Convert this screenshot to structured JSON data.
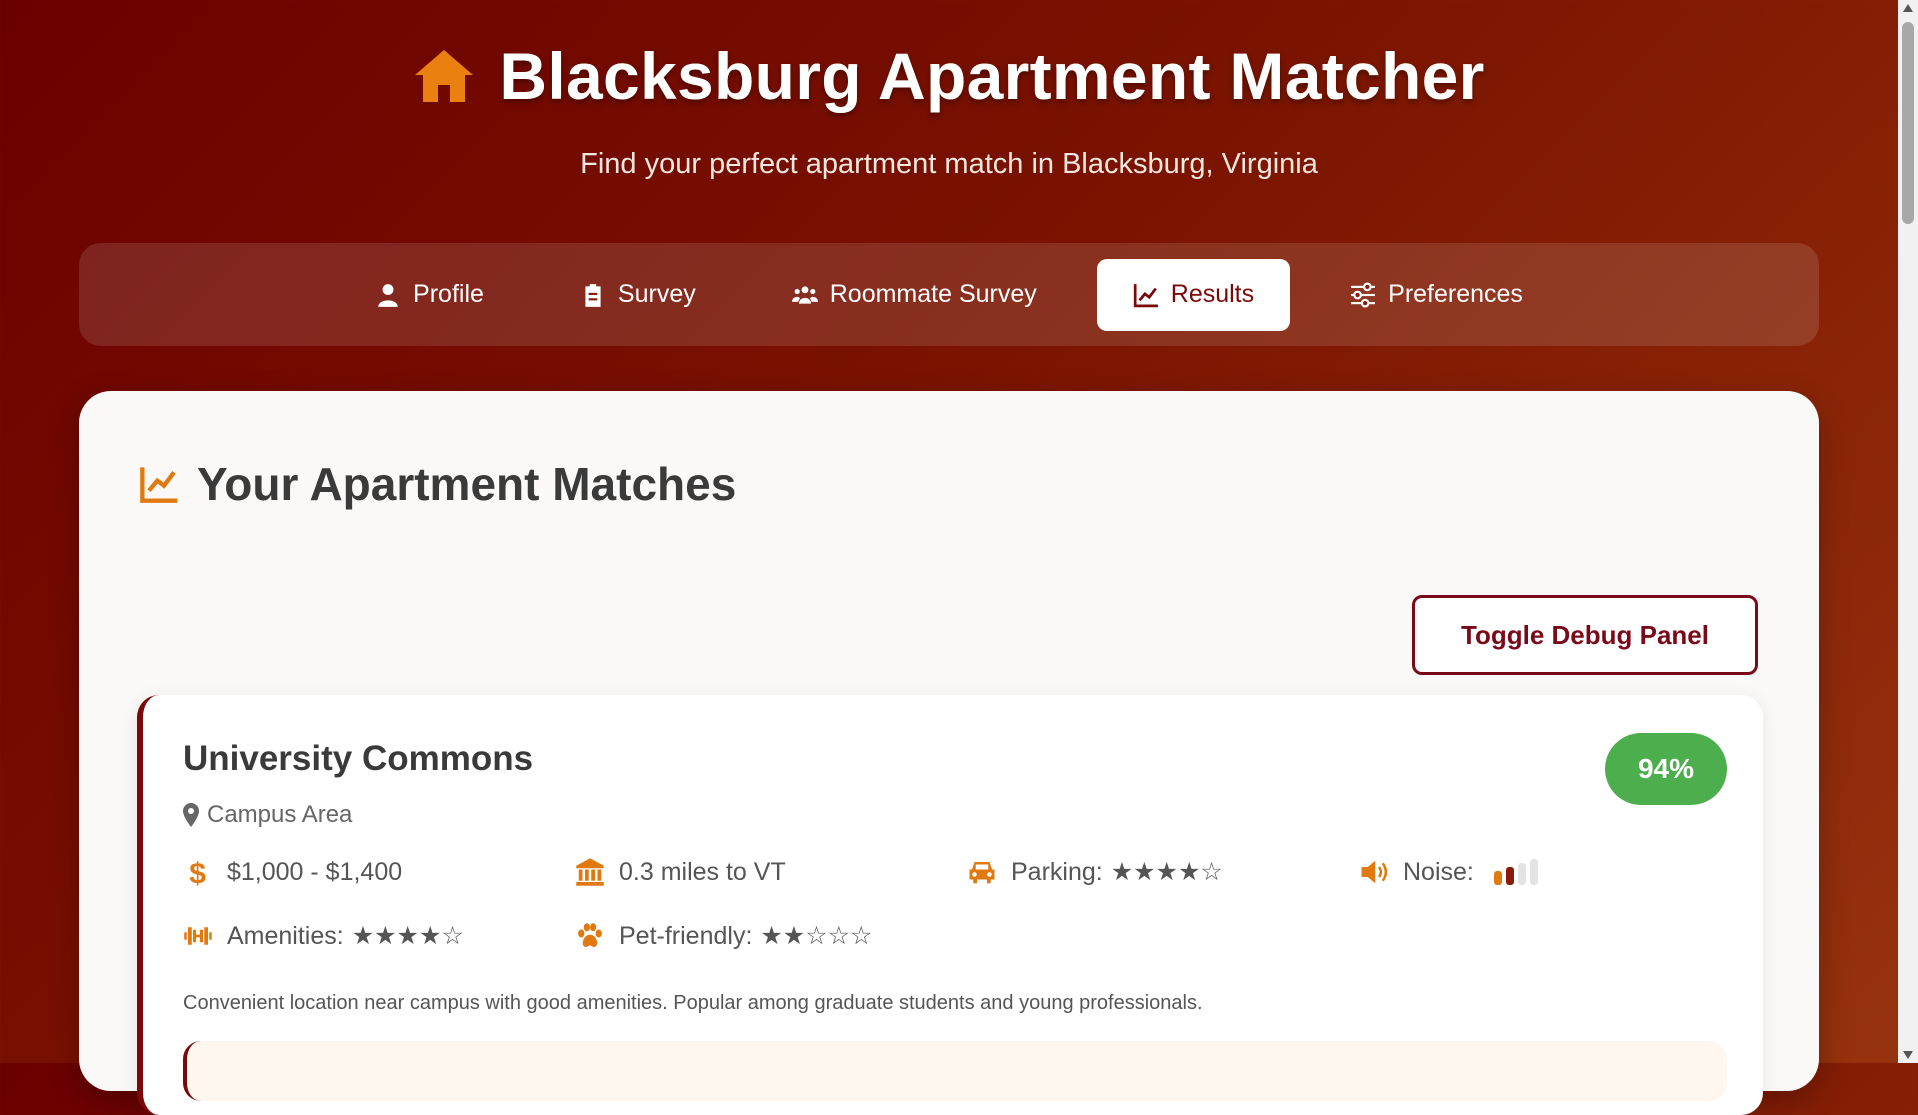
{
  "header": {
    "title": "Blacksburg Apartment Matcher",
    "subtitle": "Find your perfect apartment match in Blacksburg, Virginia",
    "icon": "home-icon"
  },
  "nav": {
    "tabs": [
      {
        "label": "Profile",
        "icon": "user-icon",
        "active": false
      },
      {
        "label": "Survey",
        "icon": "clipboard-icon",
        "active": false
      },
      {
        "label": "Roommate Survey",
        "icon": "users-icon",
        "active": false
      },
      {
        "label": "Results",
        "icon": "chart-line-icon",
        "active": true
      },
      {
        "label": "Preferences",
        "icon": "sliders-icon",
        "active": false
      }
    ]
  },
  "results": {
    "heading": "Your Apartment Matches",
    "debug_button": "Toggle Debug Panel",
    "apartments": [
      {
        "name": "University Commons",
        "location": "Campus Area",
        "match": "94%",
        "price": "$1,000 - $1,400",
        "distance": "0.3 miles to VT",
        "parking_label": "Parking:",
        "parking_stars": "★★★★☆",
        "noise_label": "Noise:",
        "noise_level": 2,
        "noise_max": 4,
        "amenities_label": "Amenities:",
        "amenities_stars": "★★★★☆",
        "pet_label": "Pet-friendly:",
        "pet_stars": "★★☆☆☆",
        "description": "Convenient location near campus with good amenities. Popular among graduate students and young professionals."
      }
    ]
  },
  "colors": {
    "accent": "#e07a10",
    "brand": "#7a0a0a",
    "match_badge": "#4cae4c"
  }
}
